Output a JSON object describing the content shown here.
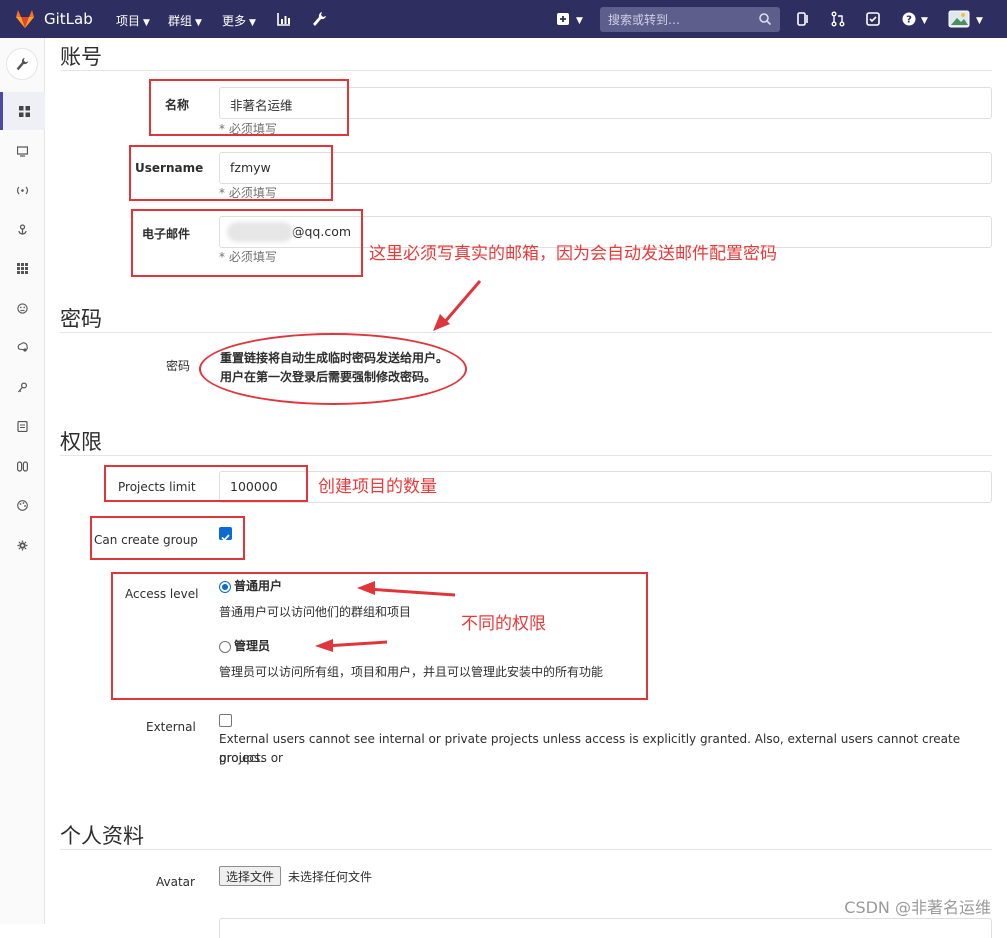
{
  "topbar": {
    "brand": "GitLab",
    "nav": [
      "项目",
      "群组",
      "更多"
    ],
    "search_placeholder": "搜索或转到…",
    "colors": {
      "bg": "#2e2e60",
      "logo": "#fc6d26"
    }
  },
  "sidebar": {
    "icons": [
      "wrench-icon",
      "overview-icon",
      "monitoring-icon",
      "messages-icon",
      "hooks-icon",
      "applications-icon",
      "abuse-reports-icon",
      "kubernetes-icon",
      "deploy-keys-icon",
      "service-templates-icon",
      "labels-icon",
      "appearance-icon",
      "settings-icon"
    ]
  },
  "account": {
    "title": "账号",
    "name_label": "名称",
    "name_value": "非著名运维",
    "username_label": "Username",
    "username_value": "fzmyw",
    "email_label": "电子邮件",
    "email_value": "@qq.com",
    "required_hint": "* 必须填写"
  },
  "password": {
    "title": "密码",
    "label": "密码",
    "text_line1": "重置链接将自动生成临时密码发送给用户。",
    "text_line2": "用户在第一次登录后需要强制修改密码。"
  },
  "permissions": {
    "title": "权限",
    "projects_limit_label": "Projects limit",
    "projects_limit_value": "100000",
    "can_create_group_label": "Can create group",
    "can_create_group_checked": true,
    "access_level_label": "Access level",
    "regular_label": "普通用户",
    "regular_desc": "普通用户可以访问他们的群组和项目",
    "admin_label": "管理员",
    "admin_desc": "管理员可以访问所有组，项目和用户，并且可以管理此安装中的所有功能",
    "selected": "普通用户",
    "external_label": "External",
    "external_checked": false,
    "external_desc_line1": "External users cannot see internal or private projects unless access is explicitly granted. Also, external users cannot create projects or",
    "external_desc_line2": "groups."
  },
  "profile": {
    "title": "个人资料",
    "avatar_label": "Avatar",
    "choose_file": "选择文件",
    "no_file": "未选择任何文件"
  },
  "annotations": {
    "email_note": "这里必须写真实的邮箱，因为会自动发送邮件配置密码",
    "projects_note": "创建项目的数量",
    "access_note": "不同的权限",
    "color": "#e83a3a"
  },
  "watermark": "CSDN @非著名运维"
}
